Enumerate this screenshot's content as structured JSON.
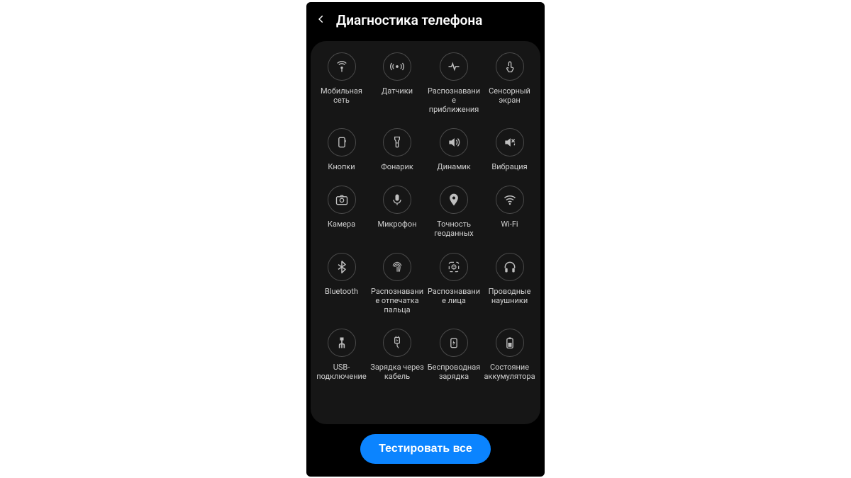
{
  "header": {
    "title": "Диагностика телефона"
  },
  "items": [
    {
      "id": "mobile-network",
      "label": "Мобильная сеть",
      "icon": "antenna"
    },
    {
      "id": "sensors",
      "label": "Датчики",
      "icon": "sensor"
    },
    {
      "id": "proximity",
      "label": "Распознавание приближения",
      "icon": "proximity"
    },
    {
      "id": "touchscreen",
      "label": "Сенсорный экран",
      "icon": "touch"
    },
    {
      "id": "buttons",
      "label": "Кнопки",
      "icon": "button"
    },
    {
      "id": "flashlight",
      "label": "Фонарик",
      "icon": "flashlight"
    },
    {
      "id": "speaker",
      "label": "Динамик",
      "icon": "speaker"
    },
    {
      "id": "vibration",
      "label": "Вибрация",
      "icon": "vibration"
    },
    {
      "id": "camera",
      "label": "Камера",
      "icon": "camera"
    },
    {
      "id": "microphone",
      "label": "Микрофон",
      "icon": "mic"
    },
    {
      "id": "location",
      "label": "Точность геоданных",
      "icon": "location"
    },
    {
      "id": "wifi",
      "label": "Wi-Fi",
      "icon": "wifi"
    },
    {
      "id": "bluetooth",
      "label": "Bluetooth",
      "icon": "bluetooth"
    },
    {
      "id": "fingerprint",
      "label": "Распознавание отпечатка пальца",
      "icon": "fingerprint"
    },
    {
      "id": "face",
      "label": "Распознавание лица",
      "icon": "face"
    },
    {
      "id": "wired-headphones",
      "label": "Проводные наушники",
      "icon": "headphones"
    },
    {
      "id": "usb",
      "label": "USB-подключение",
      "icon": "usb"
    },
    {
      "id": "cable-charge",
      "label": "Зарядка через кабель",
      "icon": "cablecharge"
    },
    {
      "id": "wireless-charge",
      "label": "Беспроводная зарядка",
      "icon": "wirelesscharge"
    },
    {
      "id": "battery",
      "label": "Состояние аккумулятора",
      "icon": "battery"
    }
  ],
  "footer": {
    "test_all_label": "Тестировать все"
  }
}
